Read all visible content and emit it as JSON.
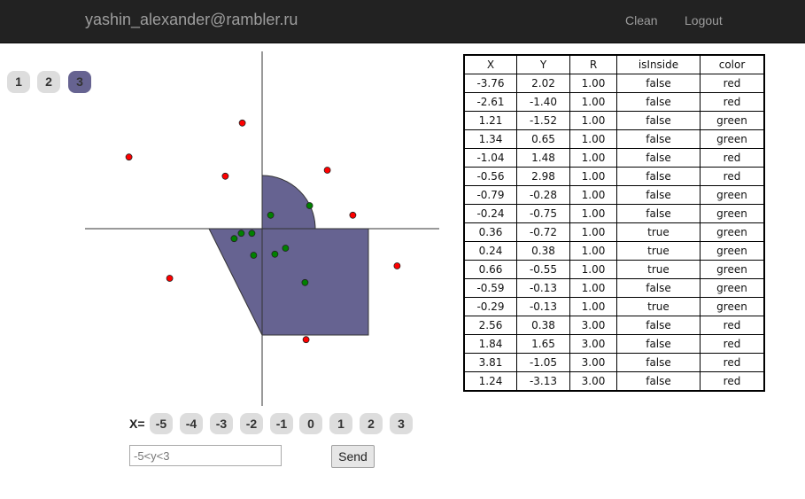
{
  "header": {
    "user": "yashin_alexander@rambler.ru",
    "clean_label": "Clean",
    "logout_label": "Logout"
  },
  "r_buttons": {
    "items": [
      "1",
      "2",
      "3"
    ],
    "selected": "3"
  },
  "graph": {
    "r": 3,
    "area_color": "#666391",
    "inside_color": "#008000",
    "outside_color": "#ff0000",
    "points": [
      {
        "x": -3.76,
        "y": 2.02,
        "color": "red"
      },
      {
        "x": -2.61,
        "y": -1.4,
        "color": "red"
      },
      {
        "x": 1.21,
        "y": -1.52,
        "color": "green"
      },
      {
        "x": 1.34,
        "y": 0.65,
        "color": "green"
      },
      {
        "x": -1.04,
        "y": 1.48,
        "color": "red"
      },
      {
        "x": -0.56,
        "y": 2.98,
        "color": "red"
      },
      {
        "x": -0.79,
        "y": -0.28,
        "color": "green"
      },
      {
        "x": -0.24,
        "y": -0.75,
        "color": "green"
      },
      {
        "x": 0.36,
        "y": -0.72,
        "color": "green"
      },
      {
        "x": 0.24,
        "y": 0.38,
        "color": "green"
      },
      {
        "x": 0.66,
        "y": -0.55,
        "color": "green"
      },
      {
        "x": -0.59,
        "y": -0.13,
        "color": "green"
      },
      {
        "x": -0.29,
        "y": -0.13,
        "color": "green"
      },
      {
        "x": 2.56,
        "y": 0.38,
        "color": "red"
      },
      {
        "x": 1.84,
        "y": 1.65,
        "color": "red"
      },
      {
        "x": 3.81,
        "y": -1.05,
        "color": "red"
      },
      {
        "x": 1.24,
        "y": -3.13,
        "color": "red"
      }
    ]
  },
  "x_selector": {
    "label": "X=",
    "values": [
      "-5",
      "-4",
      "-3",
      "-2",
      "-1",
      "0",
      "1",
      "2",
      "3"
    ]
  },
  "y_input": {
    "placeholder": "-5<y<3",
    "value": ""
  },
  "send_label": "Send",
  "table": {
    "headers": [
      "X",
      "Y",
      "R",
      "isInside",
      "color"
    ],
    "rows": [
      [
        "-3.76",
        "2.02",
        "1.00",
        "false",
        "red"
      ],
      [
        "-2.61",
        "-1.40",
        "1.00",
        "false",
        "red"
      ],
      [
        "1.21",
        "-1.52",
        "1.00",
        "false",
        "green"
      ],
      [
        "1.34",
        "0.65",
        "1.00",
        "false",
        "green"
      ],
      [
        "-1.04",
        "1.48",
        "1.00",
        "false",
        "red"
      ],
      [
        "-0.56",
        "2.98",
        "1.00",
        "false",
        "red"
      ],
      [
        "-0.79",
        "-0.28",
        "1.00",
        "false",
        "green"
      ],
      [
        "-0.24",
        "-0.75",
        "1.00",
        "false",
        "green"
      ],
      [
        "0.36",
        "-0.72",
        "1.00",
        "true",
        "green"
      ],
      [
        "0.24",
        "0.38",
        "1.00",
        "true",
        "green"
      ],
      [
        "0.66",
        "-0.55",
        "1.00",
        "true",
        "green"
      ],
      [
        "-0.59",
        "-0.13",
        "1.00",
        "false",
        "green"
      ],
      [
        "-0.29",
        "-0.13",
        "1.00",
        "true",
        "green"
      ],
      [
        "2.56",
        "0.38",
        "3.00",
        "false",
        "red"
      ],
      [
        "1.84",
        "1.65",
        "3.00",
        "false",
        "red"
      ],
      [
        "3.81",
        "-1.05",
        "3.00",
        "false",
        "red"
      ],
      [
        "1.24",
        "-3.13",
        "3.00",
        "false",
        "red"
      ]
    ]
  }
}
